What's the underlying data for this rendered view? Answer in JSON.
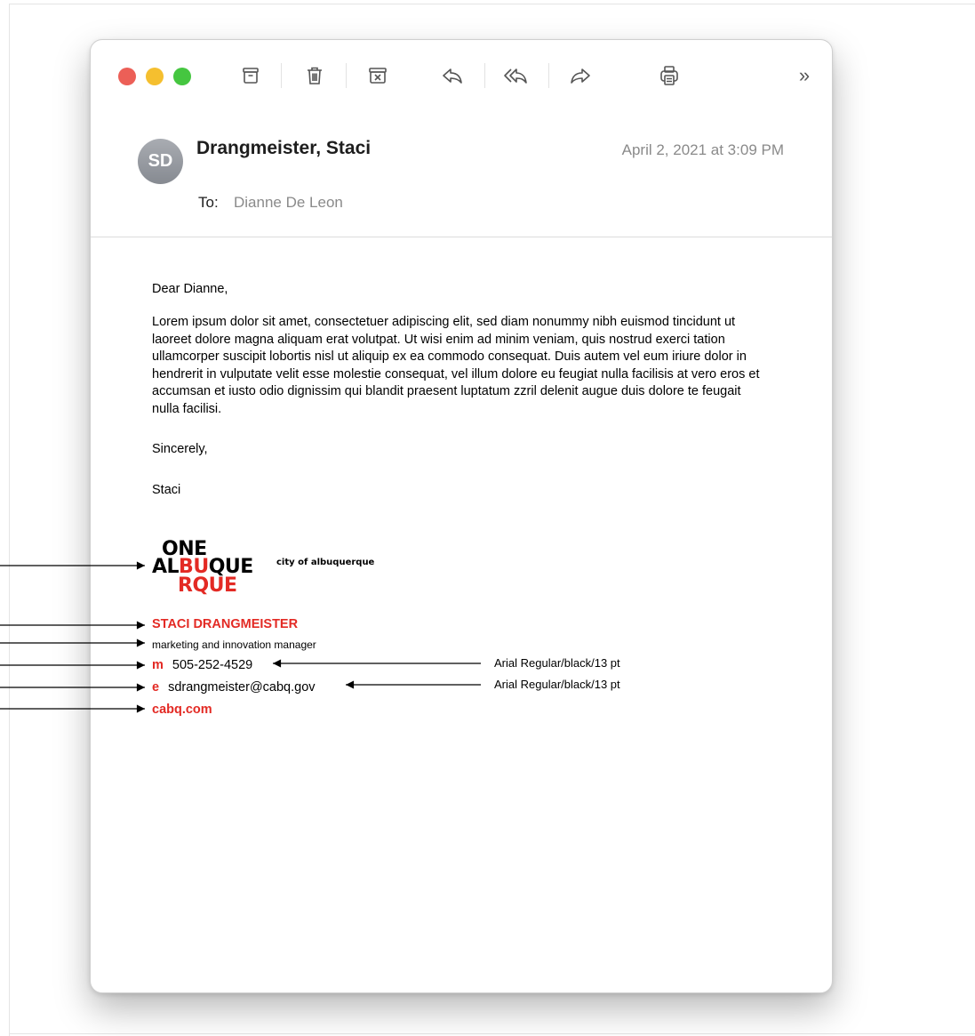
{
  "toolbar": {
    "buttons": [
      {
        "icon": "archive-icon"
      },
      {
        "icon": "trash-icon"
      },
      {
        "icon": "junk-icon"
      },
      {
        "icon": "reply-icon"
      },
      {
        "icon": "reply-all-icon"
      },
      {
        "icon": "forward-icon"
      },
      {
        "icon": "print-icon"
      },
      {
        "icon": "more-chevron-icon",
        "label": "»"
      }
    ]
  },
  "message": {
    "avatar_initials": "SD",
    "sender": "Drangmeister, Staci",
    "date": "April 2, 2021 at 3:09 PM",
    "to_label": "To:",
    "to_value": "Dianne De Leon",
    "greeting": "Dear Dianne,",
    "paragraph": "Lorem ipsum dolor sit amet, consectetuer adipiscing elit, sed diam nonummy nibh euismod tincidunt ut laoreet dolore magna aliquam erat volutpat. Ut wisi enim ad minim veniam, quis nostrud exerci tation ullamcorper suscipit lobortis nisl ut aliquip ex ea commodo consequat. Duis autem vel eum iriure dolor in hendrerit in vulputate velit esse molestie consequat, vel illum dolore eu feugiat nulla facilisis at vero eros et accumsan et iusto odio dignissim qui blandit praesent luptatum zzril delenit augue duis dolore te feugait nulla facilisi.",
    "closing": "Sincerely,",
    "signoff": "Staci"
  },
  "signature": {
    "logo_line1": "ONE",
    "logo_line2_a": "AL",
    "logo_line2_b": "BU",
    "logo_line2_c": "QUE",
    "logo_line3": "RQUE",
    "logo_tagline": "city of albuquerque",
    "name": "STACI DRANGMEISTER",
    "title": "marketing and innovation manager",
    "mobile_key": "m",
    "mobile": "505-252-4529",
    "email_key": "e",
    "email": "sdrangmeister@cabq.gov",
    "website": "cabq.com"
  },
  "annotations": {
    "mobile_note": "Arial Regular/black/13 pt",
    "email_note": "Arial Regular/black/13 pt"
  },
  "colors": {
    "brand_red": "#e32a24",
    "traffic_red": "#ec5f57",
    "traffic_yellow": "#f5bf2f",
    "traffic_green": "#45c640"
  }
}
